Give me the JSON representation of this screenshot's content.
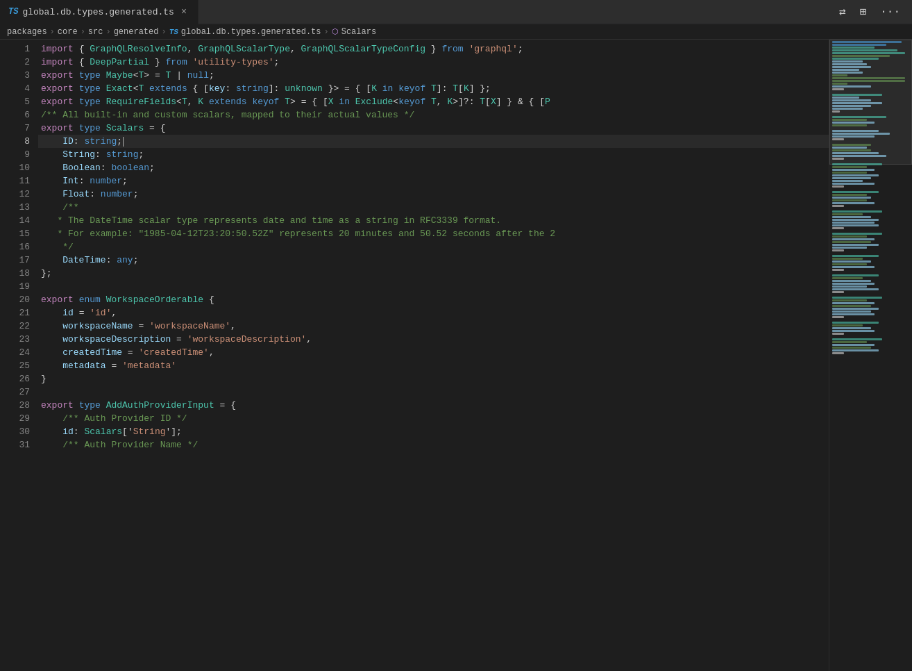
{
  "tab": {
    "ts_badge": "TS",
    "filename": "global.db.types.generated.ts",
    "close_icon": "×"
  },
  "toolbar": {
    "split_icon": "⇄",
    "layout_icon": "⊞",
    "more_icon": "···"
  },
  "breadcrumb": {
    "parts": [
      "packages",
      "core",
      "src",
      "generated",
      "global.db.types.generated.ts",
      "Scalars"
    ],
    "separators": [
      ">",
      ">",
      ">",
      ">",
      ">"
    ],
    "ts_label": "TS"
  },
  "lines": [
    {
      "num": 1,
      "content": "import_1"
    },
    {
      "num": 2,
      "content": "import_2"
    },
    {
      "num": 3,
      "content": "export_maybe"
    },
    {
      "num": 4,
      "content": "export_exact"
    },
    {
      "num": 5,
      "content": "export_require"
    },
    {
      "num": 6,
      "content": "comment_scalars"
    },
    {
      "num": 7,
      "content": "export_scalars"
    },
    {
      "num": 8,
      "content": "id_string",
      "active": true
    },
    {
      "num": 9,
      "content": "string_string"
    },
    {
      "num": 10,
      "content": "boolean_boolean"
    },
    {
      "num": 11,
      "content": "int_number"
    },
    {
      "num": 12,
      "content": "float_number"
    },
    {
      "num": 13,
      "content": "comment_jsdoc_open"
    },
    {
      "num": 14,
      "content": "comment_datetime_1"
    },
    {
      "num": 15,
      "content": "comment_datetime_2"
    },
    {
      "num": 16,
      "content": "comment_jsdoc_close"
    },
    {
      "num": 17,
      "content": "datetime_any"
    },
    {
      "num": 18,
      "content": "close_brace"
    },
    {
      "num": 19,
      "content": "empty"
    },
    {
      "num": 20,
      "content": "export_enum"
    },
    {
      "num": 21,
      "content": "enum_id"
    },
    {
      "num": 22,
      "content": "enum_workspacename"
    },
    {
      "num": 23,
      "content": "enum_workspacedesc"
    },
    {
      "num": 24,
      "content": "enum_createdtime"
    },
    {
      "num": 25,
      "content": "enum_metadata"
    },
    {
      "num": 26,
      "content": "enum_close"
    },
    {
      "num": 27,
      "content": "empty2"
    },
    {
      "num": 28,
      "content": "export_addauth"
    },
    {
      "num": 29,
      "content": "comment_auth_id"
    },
    {
      "num": 30,
      "content": "id_scalars"
    },
    {
      "num": 31,
      "content": "comment_auth_name"
    }
  ]
}
